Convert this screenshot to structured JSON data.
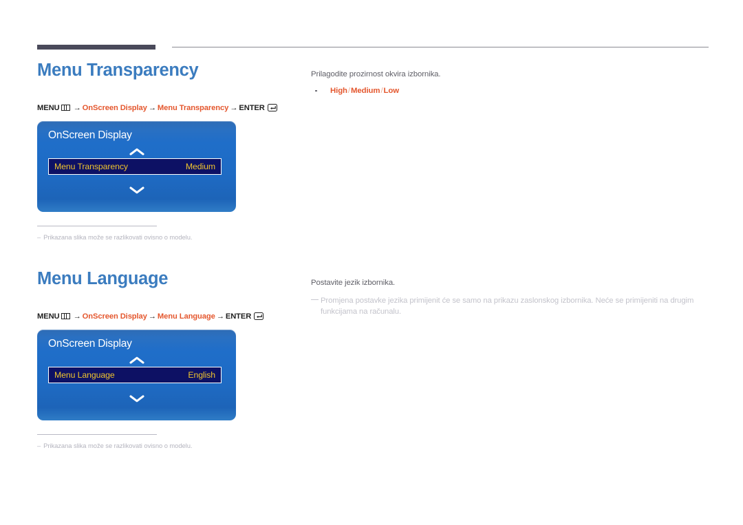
{
  "page": {
    "language_hint": "hr",
    "accent_blue": "#3b7cbf",
    "accent_orange": "#e4572e",
    "osd_highlight_bg": "#0d1164",
    "osd_highlight_text": "#f0c52e",
    "rule_dark": "#4a4a5a",
    "rule_light": "#8a8a92"
  },
  "sections": [
    {
      "id": "menu-transparency",
      "heading": "Menu Transparency",
      "breadcrumb": {
        "menu_label": "MENU",
        "menu_icon": "menu-grid-icon",
        "arrow": "→",
        "path": [
          "OnScreen Display",
          "Menu Transparency"
        ],
        "enter_label": "ENTER",
        "enter_icon": "enter-return-icon"
      },
      "osd": {
        "title": "OnScreen Display",
        "chevron_up": "chevron-up-icon",
        "chevron_down": "chevron-down-icon",
        "row_label": "Menu Transparency",
        "row_value": "Medium"
      },
      "footnote": {
        "dash": "–",
        "text": "Prikazana slika može se razlikovati ovisno o modelu."
      },
      "right": {
        "description": "Prilagodite prozirnost okvira izbornika.",
        "options": [
          "High",
          "Medium",
          "Low"
        ],
        "option_separator": "/",
        "note": null
      }
    },
    {
      "id": "menu-language",
      "heading": "Menu Language",
      "breadcrumb": {
        "menu_label": "MENU",
        "menu_icon": "menu-grid-icon",
        "arrow": "→",
        "path": [
          "OnScreen Display",
          "Menu Language"
        ],
        "enter_label": "ENTER",
        "enter_icon": "enter-return-icon"
      },
      "osd": {
        "title": "OnScreen Display",
        "chevron_up": "chevron-up-icon",
        "chevron_down": "chevron-down-icon",
        "row_label": "Menu Language",
        "row_value": "English"
      },
      "footnote": {
        "dash": "–",
        "text": "Prikazana slika može se razlikovati ovisno o modelu."
      },
      "right": {
        "description": "Postavite jezik izbornika.",
        "options": [],
        "option_separator": "/",
        "note": "Promjena postavke jezika primijenit će se samo na prikazu zaslonskog izbornika. Neće se primijeniti na drugim funkcijama na računalu."
      }
    }
  ]
}
